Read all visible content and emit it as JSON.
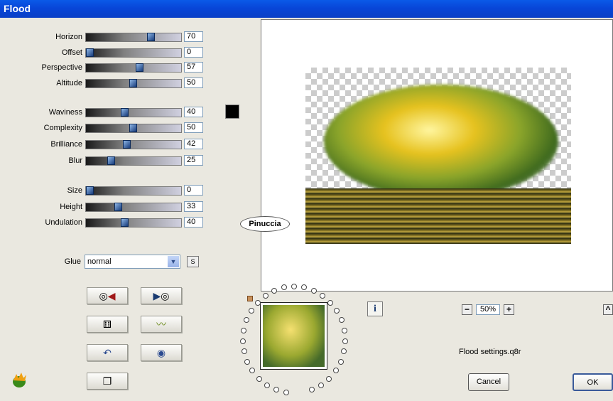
{
  "window": {
    "title": "Flood"
  },
  "groups": [
    [
      {
        "label": "Horizon",
        "value": "70"
      },
      {
        "label": "Offset",
        "value": "0"
      },
      {
        "label": "Perspective",
        "value": "57"
      },
      {
        "label": "Altitude",
        "value": "50"
      }
    ],
    [
      {
        "label": "Waviness",
        "value": "40"
      },
      {
        "label": "Complexity",
        "value": "50"
      },
      {
        "label": "Brilliance",
        "value": "42"
      },
      {
        "label": "Blur",
        "value": "25"
      }
    ],
    [
      {
        "label": "Size",
        "value": "0"
      },
      {
        "label": "Height",
        "value": "33"
      },
      {
        "label": "Undulation",
        "value": "40"
      }
    ]
  ],
  "color_swatch": "#000000",
  "glue": {
    "label": "Glue",
    "value": "normal",
    "save_label": "S"
  },
  "preset_buttons": [
    "play-reverse-icon",
    "play-forward-icon",
    "dice-icon",
    "wave-icon",
    "undo-icon",
    "circle-icon",
    "page-icon"
  ],
  "preview": {
    "signature": "Pinuccia"
  },
  "zoom": {
    "minus": "−",
    "value": "50%",
    "plus": "+"
  },
  "info_label": "i",
  "settings_file": "Flood settings.q8r",
  "buttons": {
    "cancel": "Cancel",
    "ok": "OK"
  },
  "collapse_label": "^"
}
